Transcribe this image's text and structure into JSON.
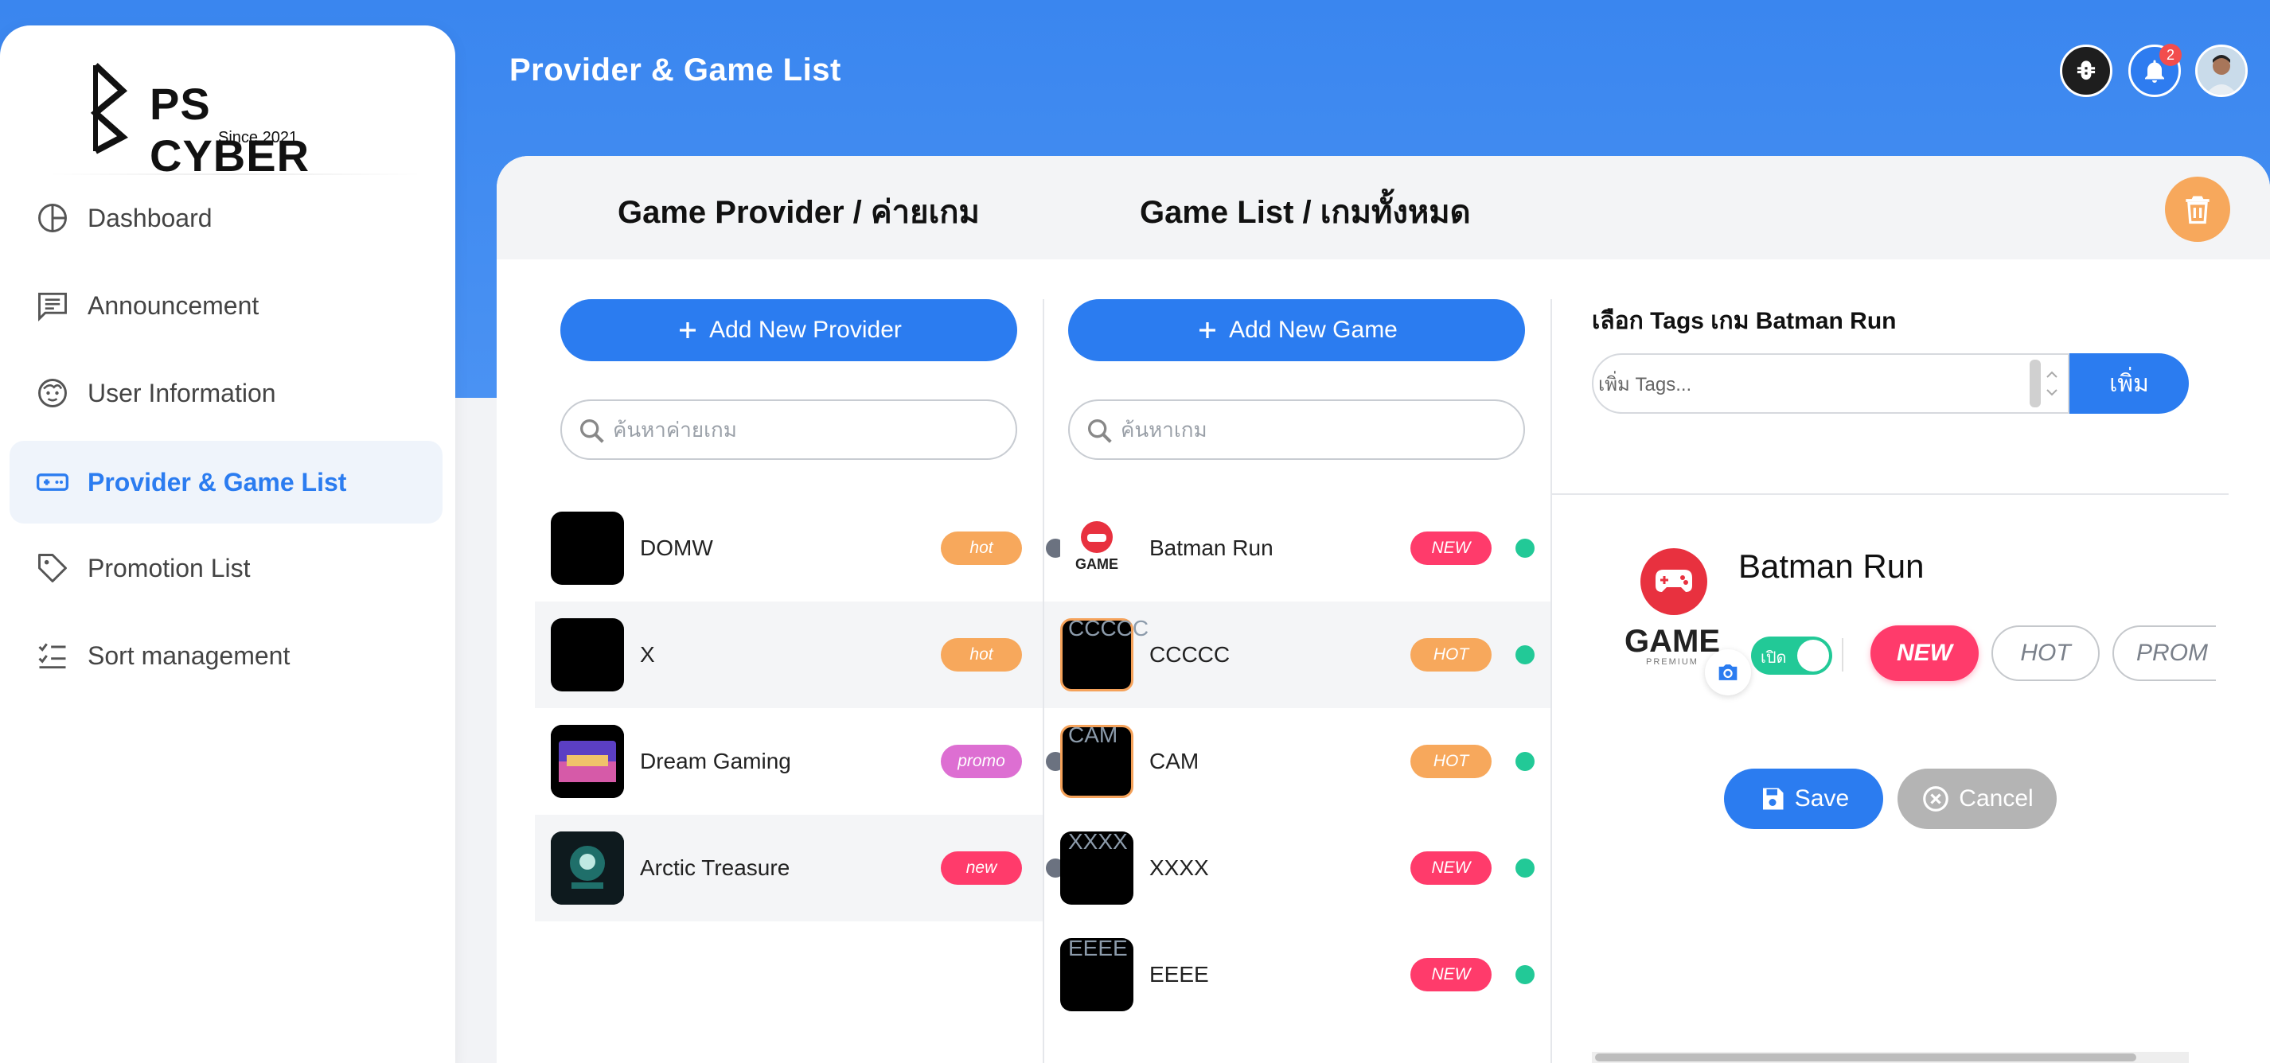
{
  "header": {
    "page_title": "Provider & Game List",
    "notification_count": "2"
  },
  "logo": {
    "title": "PS CYBER",
    "subtitle": "Since 2021"
  },
  "sidebar": {
    "items": [
      {
        "label": "Dashboard",
        "icon": "pie-chart-icon"
      },
      {
        "label": "Announcement",
        "icon": "message-icon"
      },
      {
        "label": "User Information",
        "icon": "face-icon"
      },
      {
        "label": "Provider & Game List",
        "icon": "gamepad-icon",
        "active": true
      },
      {
        "label": "Promotion List",
        "icon": "tag-icon"
      },
      {
        "label": "Sort management",
        "icon": "checklist-icon"
      }
    ]
  },
  "columns": {
    "provider_title": "Game Provider / ค่ายเกม",
    "game_title": "Game List / เกมทั้งหมด"
  },
  "providers": {
    "add_label": "Add New Provider",
    "search_placeholder": "ค้นหาค่ายเกม",
    "items": [
      {
        "name": "DOMW",
        "tag": "hot",
        "tag_color": "#f7a85c"
      },
      {
        "name": "X",
        "tag": "hot",
        "tag_color": "#f7a85c"
      },
      {
        "name": "Dream Gaming",
        "tag": "promo",
        "tag_color": "#dd6fd2"
      },
      {
        "name": "Arctic Treasure",
        "tag": "new",
        "tag_color": "#ff3b6b"
      }
    ]
  },
  "games": {
    "add_label": "Add New Game",
    "search_placeholder": "ค้นหาเกม",
    "items": [
      {
        "name": "Batman Run",
        "tag": "NEW",
        "tag_color": "#ff3b6b",
        "thumb_caption": ""
      },
      {
        "name": "CCCCC",
        "tag": "HOT",
        "tag_color": "#f7a85c",
        "thumb_caption": "CCCCC"
      },
      {
        "name": "CAM",
        "tag": "HOT",
        "tag_color": "#f7a85c",
        "thumb_caption": "CAM"
      },
      {
        "name": "XXXX",
        "tag": "NEW",
        "tag_color": "#ff3b6b",
        "thumb_caption": "XXXX"
      },
      {
        "name": "EEEE",
        "tag": "NEW",
        "tag_color": "#ff3b6b",
        "thumb_caption": "EEEE"
      }
    ]
  },
  "detail": {
    "tags_title": "เลือก Tags เกม Batman Run",
    "tags_placeholder": "เพิ่ม Tags...",
    "add_tag_label": "เพิ่ม",
    "logo_text": "GAME",
    "logo_sub": "PREMIUM",
    "game_name": "Batman Run",
    "toggle_label": "เปิด",
    "pills": [
      "NEW",
      "HOT",
      "PROM"
    ],
    "save_label": "Save",
    "cancel_label": "Cancel"
  },
  "colors": {
    "primary": "#2b7cf0",
    "status_gray": "#6b7280",
    "status_green": "#22c997"
  }
}
